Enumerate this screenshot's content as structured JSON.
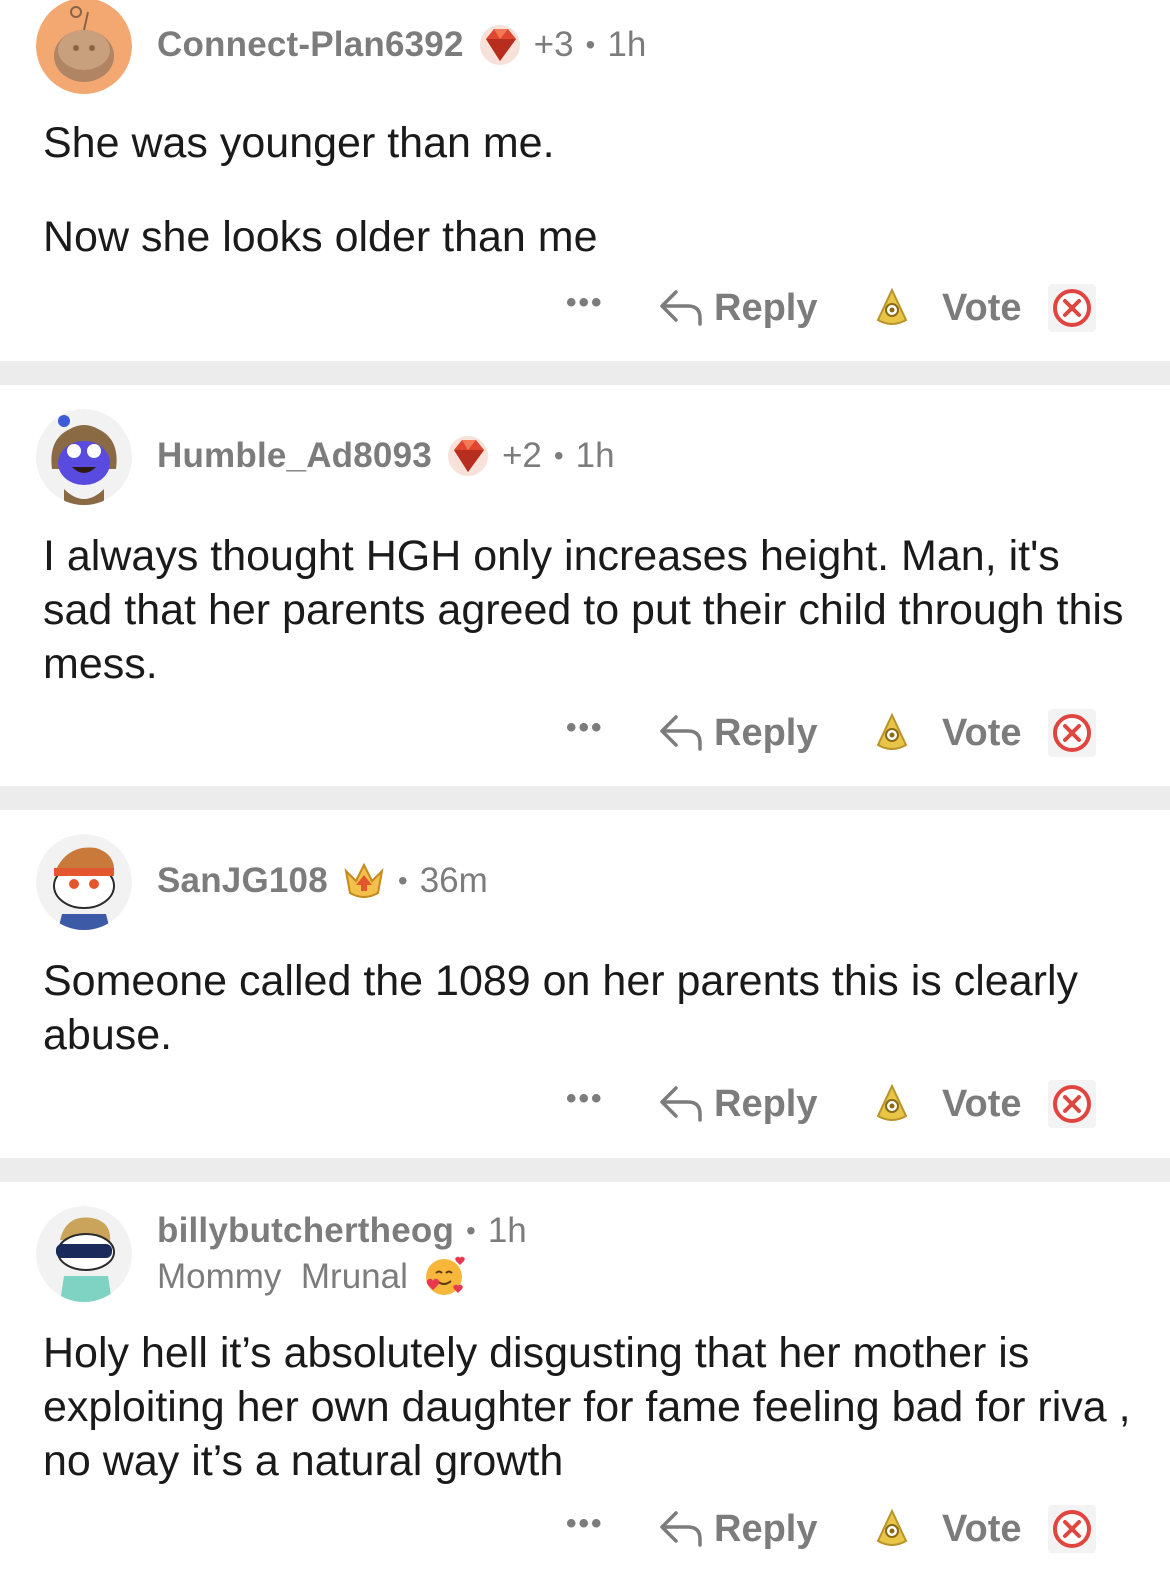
{
  "actions": {
    "more_label": "•••",
    "reply_label": "Reply",
    "vote_label": "Vote"
  },
  "comments": [
    {
      "username": "Connect-Plan6392",
      "points": "+3",
      "separator": "•",
      "time": "1h",
      "paragraphs": [
        "She was younger than me.",
        "Now she looks older than me"
      ]
    },
    {
      "username": "Humble_Ad8093",
      "points": "+2",
      "separator": "•",
      "time": "1h",
      "paragraphs": [
        "I always thought HGH only increases height. Man, it's sad that her parents agreed to put their child through this mess."
      ]
    },
    {
      "username": "SanJG108",
      "separator": "•",
      "time": "36m",
      "paragraphs": [
        "Someone called the 1089 on her parents this is clearly abuse."
      ]
    },
    {
      "username": "billybutchertheog",
      "separator": "•",
      "time": "1h",
      "flair_text": "Mommy  Mrunal",
      "paragraphs": [
        "Holy hell it’s absolutely disgusting that her mother is exploiting her own daughter for fame feeling bad for riva , no way it’s a natural growth"
      ]
    }
  ],
  "icons": {
    "gem": "gem-award-icon",
    "trophy": "trophy-award-icon",
    "award": "award-icon",
    "close": "close-icon",
    "reply": "reply-arrow-icon",
    "emoji": "smiling-face-hearts-icon"
  },
  "colors": {
    "meta_text": "#7c7c7c",
    "body_text": "#1a1a1b",
    "divider": "#ececec",
    "close_red": "#e0463f",
    "award_gold": "#e8c547"
  }
}
